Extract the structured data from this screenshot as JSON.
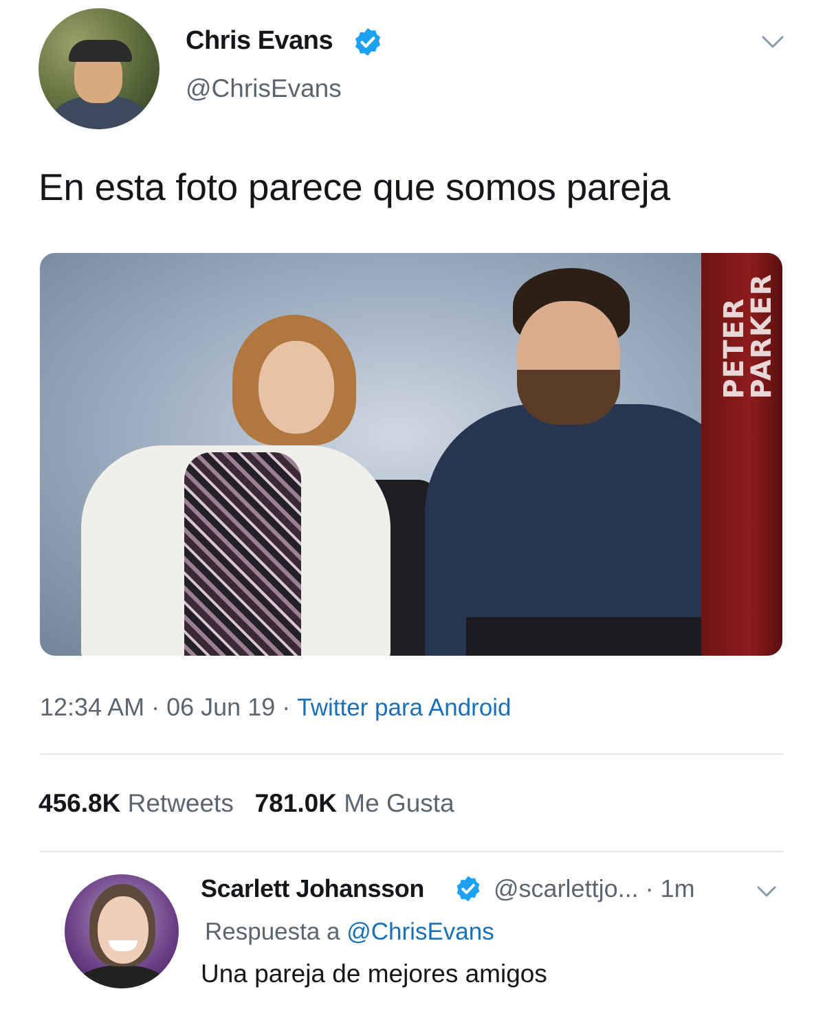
{
  "tweet": {
    "author": {
      "display_name": "Chris Evans",
      "handle": "@ChrisEvans",
      "verified": true,
      "verified_color": "#1da1f2"
    },
    "text": "En esta foto parece que somos pareja",
    "photo": {
      "banner_text": "PETER\nPARKER"
    },
    "meta": {
      "time": "12:34 AM",
      "separator": " · ",
      "date": "06 Jun 19",
      "source": "Twitter para Android"
    },
    "stats": {
      "retweets_count": "456.8K",
      "retweets_label": "Retweets",
      "likes_count": "781.0K",
      "likes_label": "Me Gusta"
    }
  },
  "reply": {
    "display_name": "Scarlett Johansson",
    "verified": true,
    "handle": "@scarlettjo...",
    "time_separator": " · ",
    "time": "1m",
    "reply_to_label": "Respuesta a ",
    "reply_to_handle": "@ChrisEvans",
    "text": "Una pareja de mejores amigos"
  },
  "icons": {
    "verified": "verified-badge-icon",
    "menu": "chevron-down-icon"
  },
  "colors": {
    "link": "#1a6fb5",
    "secondary_text": "#5b6570",
    "primary_text": "#14171a"
  }
}
